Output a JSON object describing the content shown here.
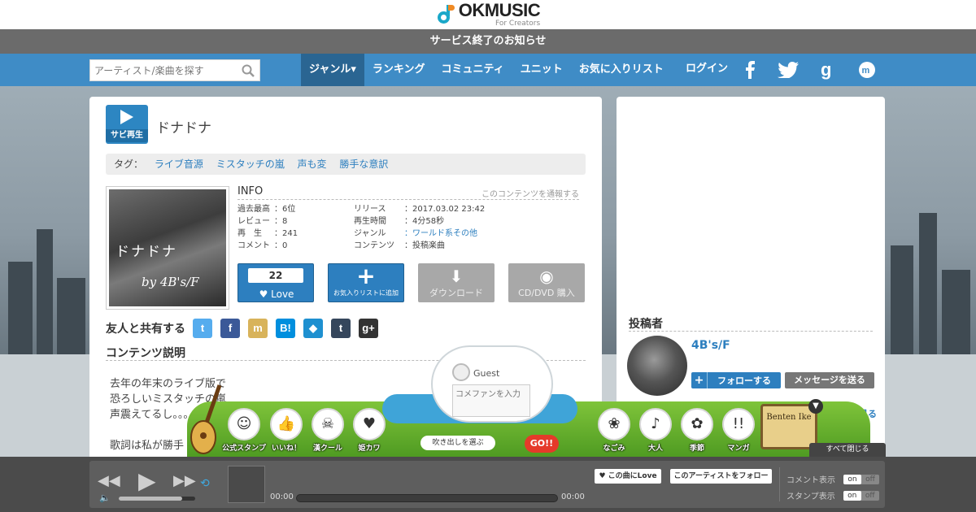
{
  "brand": {
    "name": "OKMUSIC",
    "tagline": "For Creators"
  },
  "notice": "サービス終了のお知らせ",
  "search": {
    "placeholder": "アーティスト/楽曲を探す"
  },
  "nav": {
    "items": [
      {
        "label": "ジャンル▾"
      },
      {
        "label": "ランキング"
      },
      {
        "label": "コミュニティ"
      },
      {
        "label": "ユニット"
      },
      {
        "label": "お気に入りリスト"
      }
    ],
    "login": "ログイン"
  },
  "song": {
    "sabi_label": "サビ再生",
    "title": "ドナドナ",
    "tag_label": "タグ：",
    "tags": [
      "ライブ音源",
      "ミスタッチの嵐",
      "声も変",
      "勝手な意訳"
    ],
    "jacket_text1": "ドナドナ",
    "jacket_text2": "by 4B's/F"
  },
  "info": {
    "heading": "INFO",
    "report": "このコンテンツを通報する",
    "rows": [
      {
        "k": "過去最高",
        "v": "：6位",
        "k2": "リリース",
        "v2": "：2017.03.02 23:42"
      },
      {
        "k": "レビュー",
        "v": "：8",
        "k2": "再生時間",
        "v2": "：4分58秒"
      },
      {
        "k": "再　生",
        "v": "：241",
        "k2": "ジャンル",
        "v2": "：ワールド系その他"
      },
      {
        "k": "コメント",
        "v": "：0",
        "k2": "コンテンツ",
        "v2": "：投稿楽曲"
      }
    ]
  },
  "actions": {
    "love_count": "22",
    "love_label": "♥ Love",
    "fav_label": "お気入りリストに追加",
    "download_label": "ダウンロード",
    "cd_label": "CD/DVD 購入"
  },
  "share": {
    "label": "友人と共有する"
  },
  "description": {
    "heading": "コンテンツ説明",
    "lines": [
      "去年の年末のライブ版で",
      "恐ろしいミスタッチの嵐",
      "声震えてるし。。。",
      "",
      "歌詞は私が勝手"
    ]
  },
  "poster": {
    "heading": "投稿者",
    "name": "4B's/F",
    "follow_label": "フォローする",
    "message_label": "メッセージを送る",
    "more_label": "もっと見る"
  },
  "stamp_panel": {
    "guest": "Guest",
    "comment_placeholder": "コメファンを入力",
    "select_label": "吹き出しを選ぶ",
    "go_label": "GO!!",
    "sign_text": "Benten Ike",
    "close_all": "すべて閉じる",
    "stamps_left": [
      {
        "label": "公式スタンプ",
        "glyph": "☺"
      },
      {
        "label": "いいね！",
        "glyph": "👍"
      },
      {
        "label": "漢クール",
        "glyph": "☠"
      },
      {
        "label": "姫カワ",
        "glyph": "♥"
      }
    ],
    "stamps_right": [
      {
        "label": "なごみ",
        "glyph": "❀"
      },
      {
        "label": "大人",
        "glyph": "♪"
      },
      {
        "label": "季節",
        "glyph": "✿"
      },
      {
        "label": "マンガ",
        "glyph": "!!"
      }
    ]
  },
  "player": {
    "time_current": "00:00",
    "time_total": "00:00",
    "love_btn": "♥ この曲にLove",
    "follow_btn": "このアーティストをフォロー",
    "comment_toggle": "コメント表示",
    "stamp_toggle": "スタンプ表示",
    "on": "on",
    "off": "off",
    "volume_fraction": 0.83
  }
}
